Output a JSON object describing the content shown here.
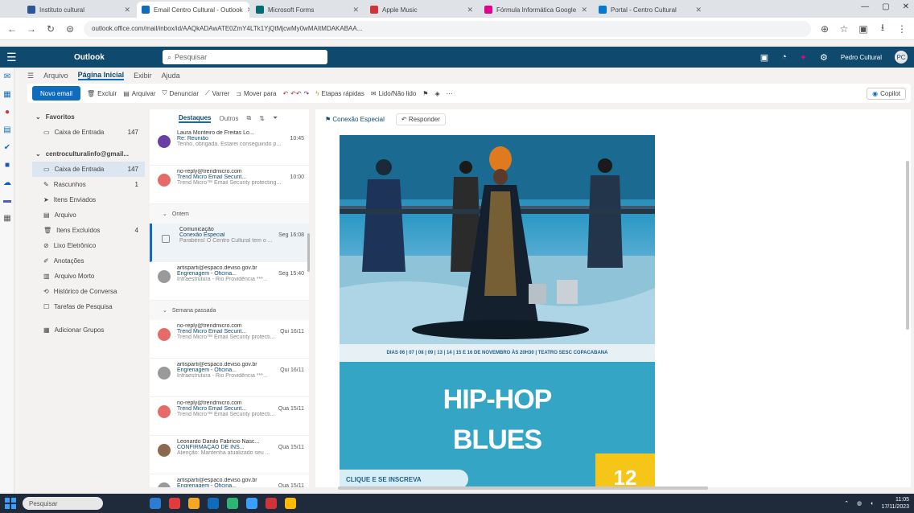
{
  "browser": {
    "tabs": [
      {
        "label": "Instituto cultural",
        "color": "#2b579a"
      },
      {
        "label": "Email Centro Cultural - Outlook",
        "color": "#0f6cbd"
      },
      {
        "label": "Microsoft Forms",
        "color": "#036c70"
      },
      {
        "label": "Apple Music",
        "color": "#d13438"
      },
      {
        "label": "Fórmula Informática Google",
        "color": "#e3008c"
      },
      {
        "label": "Portal - Centro Cultural",
        "color": "#0078d4"
      }
    ],
    "url": "outlook.office.com/mail/inbox/id/AAQkADAwATE0ZmY4LTk1YjQtMjcwMy0wMAItMDAKABAA...",
    "window_controls": [
      "—",
      "▢",
      "✕"
    ]
  },
  "outlook": {
    "brand": "Outlook",
    "search_placeholder": "Pesquisar",
    "user_name": "Pedro Cultural",
    "avatar_initials": "PC"
  },
  "ribbon_tabs": [
    "Arquivo",
    "Página Inicial",
    "Exibir",
    "Ajuda"
  ],
  "ribbon": {
    "new_mail": "Novo email",
    "items": [
      "Excluir",
      "Arquivar",
      "Denunciar",
      "Varrer",
      "Mover para",
      "Responder",
      "Etapas rápidas",
      "Lido/Não lido",
      "Sinalizar",
      "Categorizar"
    ],
    "copilot": "Copilot"
  },
  "folders": {
    "favorites_header": "Favoritos",
    "favorites": [
      {
        "label": "Caixa de Entrada",
        "count": "147"
      }
    ],
    "account_header": "centroculturalinfo@gmail...",
    "items": [
      {
        "label": "Caixa de Entrada",
        "count": "147",
        "selected": true
      },
      {
        "label": "Rascunhos",
        "count": "1"
      },
      {
        "label": "Itens Enviados",
        "count": ""
      },
      {
        "label": "Arquivo",
        "count": ""
      },
      {
        "label": "Itens Excluídos",
        "count": "4"
      },
      {
        "label": "Lixo Eletrônico",
        "count": ""
      },
      {
        "label": "Anotações",
        "count": ""
      },
      {
        "label": "Arquivo Morto",
        "count": ""
      },
      {
        "label": "Histórico de Conversa",
        "count": ""
      },
      {
        "label": "Tarefas de Pesquisa",
        "count": ""
      }
    ],
    "add_group": "Adicionar Grupos"
  },
  "list": {
    "tabs": [
      "Destaques",
      "Outros"
    ],
    "messages_top": [
      {
        "sender": "Laura Monteiro de Freitas Lo...",
        "subject": "Re: Reunião",
        "time": "10:45",
        "preview": "Tenho, obrigada. Estarei conseguindo p...",
        "avatar": "#6b3fa0"
      },
      {
        "sender": "no-reply@trendmicro.com",
        "subject": "Trend Micro Email Securit...",
        "time": "10:00",
        "preview": "Trend Micro™ Email Security protecting...",
        "avatar": "#e66c6c"
      }
    ],
    "group_ontem": "Ontem",
    "messages_ontem": [
      {
        "sender": "Comunicação",
        "subject": "Conexão Especial",
        "time": "Seg 16:08",
        "preview": "Parabéns! O Centro Cultural tem o ...",
        "avatar": "",
        "selected": true
      },
      {
        "sender": "artisparti@espaco.deviso.gov.br",
        "subject": "Engrenagem - Oficina...",
        "time": "Seg 15:40",
        "preview": "Infraestrutura - Rio Providência ***...",
        "avatar": "#9a9a9a"
      }
    ],
    "group_semana": "Semana passada",
    "messages_semana": [
      {
        "sender": "no-reply@trendmicro.com",
        "subject": "Trend Micro Email Securit...",
        "time": "Qui 16/11",
        "preview": "Trend Micro™ Email Security protecti...",
        "avatar": "#e66c6c"
      },
      {
        "sender": "artisparti@espaco.deviso.gov.br",
        "subject": "Engrenagem - Oficina...",
        "time": "Qui 16/11",
        "preview": "Infraestrutura - Rio Providência ***...",
        "avatar": "#9a9a9a"
      },
      {
        "sender": "no-reply@trendmicro.com",
        "subject": "Trend Micro Email Securit...",
        "time": "Qua 15/11",
        "preview": "Trend Micro™ Email Security protecti...",
        "avatar": "#e66c6c"
      },
      {
        "sender": "Leonardo Danilo Fabrício Nasc...",
        "subject": "CONFIRMAÇÃO DE INS...",
        "time": "Qua 15/11",
        "preview": "Atenção: Mantenha atualizado seu ...",
        "avatar": "#8a6a4f"
      },
      {
        "sender": "artisparti@espaco.deviso.gov.br",
        "subject": "Engrenagem - Oficina...",
        "time": "Qua 15/11",
        "preview": "Infraestrutura - Rio Providência ***...",
        "avatar": "#9a9a9a"
      }
    ]
  },
  "reading": {
    "folder_chip": "Conexão Especial",
    "reply_all": "Responder",
    "date_line": "DIAS 06 | 07 | 08 | 09 | 13 | 14 | 15 E 16 DE NOVEMBRO ÀS 20H30 | TEATRO SESC COPACABANA",
    "hip": "HIP-HOP",
    "blues": "BLUES",
    "cta": "CLIQUE E SE INSCREVA",
    "badge": "12"
  },
  "taskbar": {
    "search": "Pesquisar",
    "apps": [
      "#2b7cd3",
      "#e23b3b",
      "#f5a623",
      "#0f6cbd",
      "#2bb673",
      "#3aa0ff",
      "#d13438",
      "#ffb900"
    ],
    "time": "11:05",
    "date": "17/11/2023"
  }
}
